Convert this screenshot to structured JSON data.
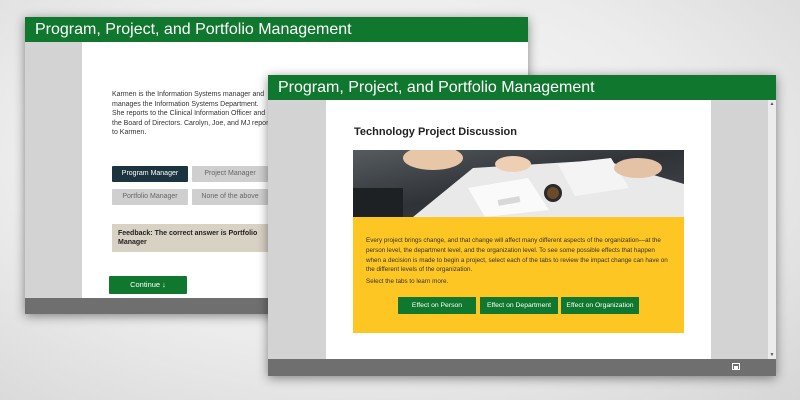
{
  "back_window": {
    "title": "Program, Project, and Portfolio Management",
    "question_text": "Karmen is the Information Systems manager and manages the Information Systems Department. She reports to the Clinical Information Officer and the Board of Directors. Carolyn, Joe, and MJ report to Karmen.",
    "options": [
      {
        "label": "Program Manager",
        "state": "selected"
      },
      {
        "label": "Project Manager",
        "state": "normal"
      },
      {
        "label": "Portfolio Manager",
        "state": "normal"
      },
      {
        "label": "None of the above",
        "state": "normal"
      }
    ],
    "feedback": "Feedback: The correct answer is Portfolio Manager",
    "continue_label": "Continue ↓"
  },
  "front_window": {
    "title": "Program, Project, and Portfolio Management",
    "heading": "Technology Project Discussion",
    "paragraph": "Every project brings change, and that change will affect many different aspects of the organization—at the person level, the department level, and the organization level. To see some possible effects that happen when a decision is made to begin a project, select each of the tabs to review the impact change can have on the different levels of the organization.",
    "instruction": "Select the tabs to learn more.",
    "tabs": [
      "Effect on Person",
      "Effect on Department",
      "Effect on Organization"
    ]
  },
  "colors": {
    "title_green": "#10782e",
    "button_green": "#10782e",
    "panel_yellow": "#fec623",
    "selected_option": "#1c3340",
    "footer_gray": "#6f6f6f"
  },
  "icons": [
    "expand-icon",
    "scroll-up-icon",
    "scroll-down-icon"
  ]
}
